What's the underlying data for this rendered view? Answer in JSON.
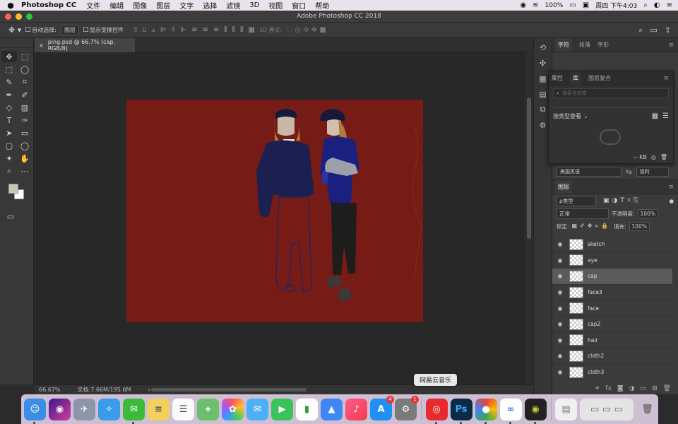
{
  "menubar": {
    "app_name": "Photoshop CC",
    "items": [
      "文件",
      "编辑",
      "图像",
      "图层",
      "文字",
      "选择",
      "滤镜",
      "3D",
      "视图",
      "窗口",
      "帮助"
    ],
    "battery": "100%",
    "clock": "周四 下午4:03"
  },
  "window": {
    "title": "Adobe Photoshop CC 2018"
  },
  "options": {
    "auto_select_label": "自动选择:",
    "auto_select_value": "图层",
    "show_transform_label": "显示变换控件",
    "mode_3d_label": "3D 模式:"
  },
  "document": {
    "tab_label": "ping.psd @ 66.7% (cap, RGB/8)",
    "canvas_color": "#771b17"
  },
  "status": {
    "zoom": "66.67%",
    "doc_size": "文档:7.66M/195.6M"
  },
  "panels": {
    "top_tabs": [
      "字符",
      "段落",
      "字形"
    ],
    "library_tabs": [
      "属性",
      "库",
      "图层复合"
    ],
    "library_search_placeholder": "搜索当前库",
    "view_by_type": "按类型查看",
    "size_kb": "-- KB",
    "language": "美国英语",
    "antialias": "锐利",
    "aa_label": "ªa"
  },
  "layers": {
    "title": "图层",
    "filter_kind": "ρ类型",
    "blend_mode": "正常",
    "opacity_label": "不透明度:",
    "opacity_value": "100%",
    "lock_label": "锁定:",
    "fill_label": "填充:",
    "fill_value": "100%",
    "items": [
      {
        "name": "sketch"
      },
      {
        "name": "aye"
      },
      {
        "name": "cap"
      },
      {
        "name": "face3"
      },
      {
        "name": "face"
      },
      {
        "name": "cap2"
      },
      {
        "name": "hair"
      },
      {
        "name": "cloth2"
      },
      {
        "name": "cloth3"
      }
    ],
    "selected": "cap"
  },
  "dock": {
    "tooltip": "网易云音乐",
    "appstore_badge": "4",
    "prefs_badge": "1",
    "apps": [
      "finder-icon",
      "siri-icon",
      "launchpad-icon",
      "safari-icon",
      "wechat-icon",
      "notes-icon",
      "reminders-icon",
      "maps-icon",
      "photos-icon",
      "messages-icon",
      "facetime-icon",
      "numbers-icon",
      "keynote-icon",
      "music-icon",
      "app-store-icon",
      "system-preferences-icon",
      "netease-music-icon",
      "photoshop-icon",
      "chrome-icon",
      "baidu-netdisk-icon",
      "quicktime-icon",
      "document-icon",
      "screenshot-icon",
      "trash-icon"
    ]
  }
}
